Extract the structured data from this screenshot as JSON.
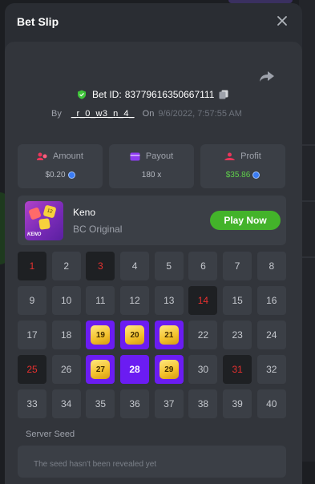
{
  "modal": {
    "title": "Bet Slip"
  },
  "bet": {
    "id_label": "Bet ID:",
    "id": "83779616350667111",
    "by_label": "By",
    "user": "_r_0_w3_n_4_",
    "on_label": "On",
    "date": "9/6/2022, 7:57:55 AM"
  },
  "stats": {
    "amount": {
      "label": "Amount",
      "value": "$0.20"
    },
    "payout": {
      "label": "Payout",
      "value": "180 x"
    },
    "profit": {
      "label": "Profit",
      "value": "$35.86"
    }
  },
  "game": {
    "name": "Keno",
    "subtitle": "BC Original",
    "thumb_text": "KENO",
    "thumb_die": "12",
    "play_label": "Play Now"
  },
  "keno": {
    "numbers": [
      1,
      2,
      3,
      4,
      5,
      6,
      7,
      8,
      9,
      10,
      11,
      12,
      13,
      14,
      15,
      16,
      17,
      18,
      19,
      20,
      21,
      22,
      23,
      24,
      25,
      26,
      27,
      28,
      29,
      30,
      31,
      32,
      33,
      34,
      35,
      36,
      37,
      38,
      39,
      40
    ],
    "drawn_miss": [
      1,
      3,
      14,
      25,
      31
    ],
    "matched": [
      19,
      20,
      21,
      27,
      29
    ],
    "selected_no_match": [
      28
    ]
  },
  "seed": {
    "label": "Server Seed",
    "value": "The seed hasn't been revealed yet"
  },
  "colors": {
    "accent": "#6b1cf2",
    "play": "#43b32a",
    "profit": "#5fd04a",
    "miss": "#e8302f"
  },
  "icons": [
    "shield-icon",
    "copy-icon",
    "share-icon",
    "close-icon",
    "amount-icon",
    "payout-icon",
    "profit-icon",
    "coin-icon"
  ]
}
